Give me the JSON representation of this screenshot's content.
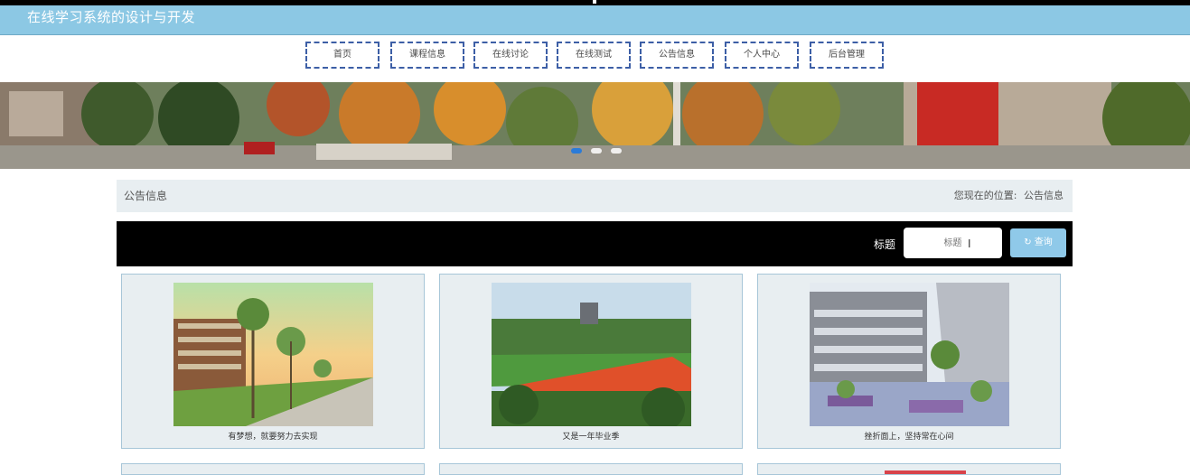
{
  "site": {
    "title": "在线学习系统的设计与开发"
  },
  "nav": {
    "items": [
      {
        "label": "首页",
        "name": "nav-home"
      },
      {
        "label": "课程信息",
        "name": "nav-course-info"
      },
      {
        "label": "在线讨论",
        "name": "nav-online-discussion"
      },
      {
        "label": "在线测试",
        "name": "nav-online-test"
      },
      {
        "label": "公告信息",
        "name": "nav-announcements"
      },
      {
        "label": "个人中心",
        "name": "nav-personal-center"
      },
      {
        "label": "后台管理",
        "name": "nav-admin"
      }
    ]
  },
  "banner": {
    "slides": 3,
    "active_slide": 1
  },
  "breadcrumb": {
    "title": "公告信息",
    "location_label": "您现在的位置:",
    "location_value": "公告信息"
  },
  "search": {
    "label": "标题",
    "placeholder": "标题",
    "button_label": "查询",
    "button_icon": "refresh-icon"
  },
  "announcements": [
    {
      "caption": "有梦想，就要努力去实现"
    },
    {
      "caption": "又是一年毕业季"
    },
    {
      "caption": "挫折面上，坚持常在心间"
    }
  ],
  "colors": {
    "header_bg": "#8cc8e4",
    "nav_border": "#3d5fa6",
    "search_bar_bg": "#000000",
    "search_button_bg": "#8fc9e9",
    "card_bg": "#e8eef1"
  }
}
